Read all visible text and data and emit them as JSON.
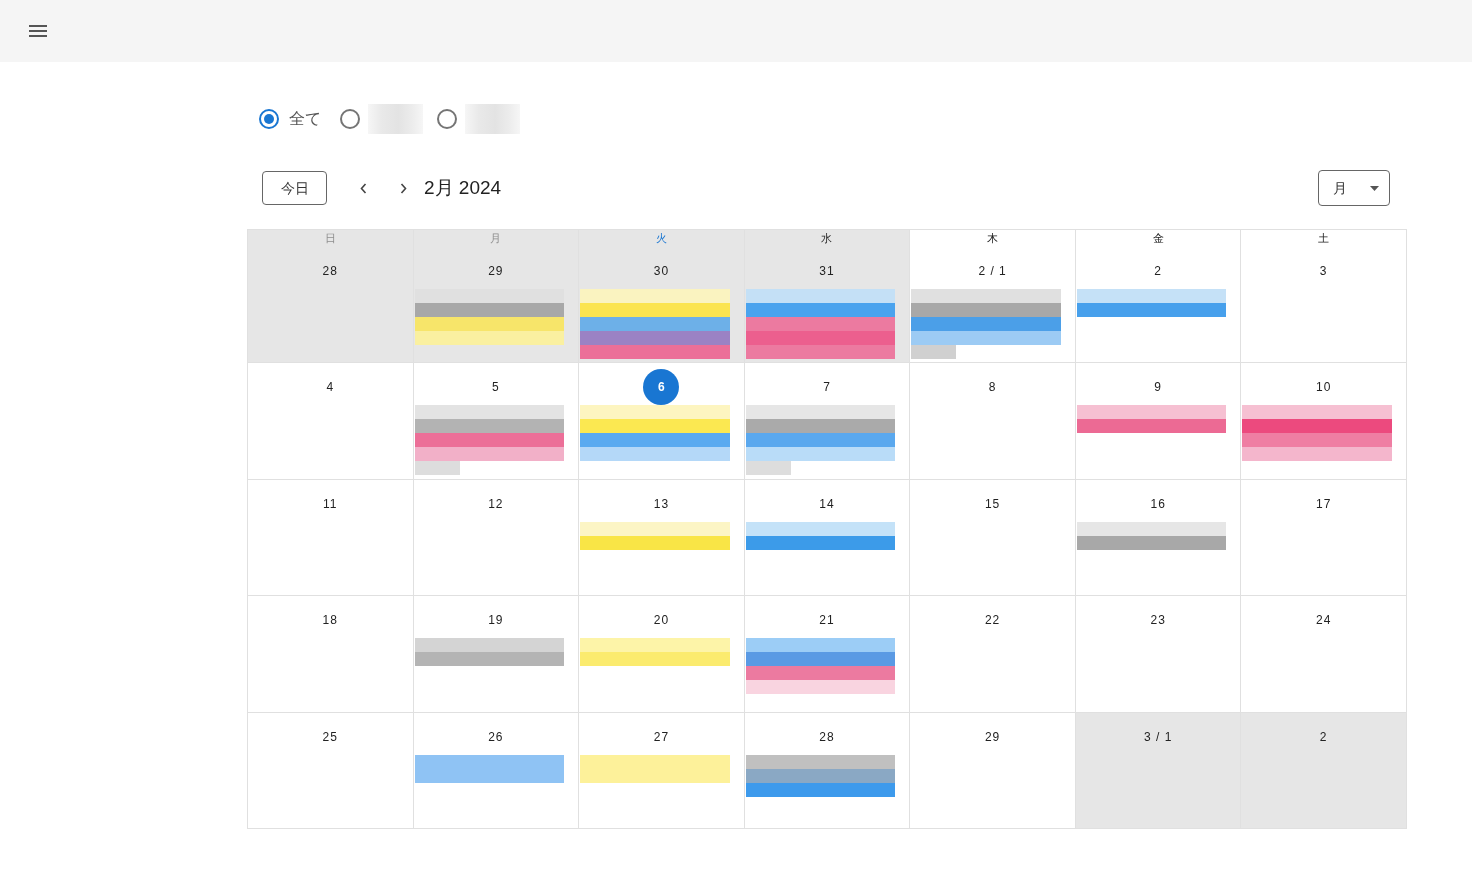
{
  "filters": [
    {
      "label": "全て",
      "selected": true
    },
    {
      "selected": false
    },
    {
      "selected": false
    }
  ],
  "toolbar": {
    "today_button": "今日",
    "title": "2月 2024",
    "view_button": "月"
  },
  "calendar": {
    "weekdays": [
      {
        "label": "日",
        "kind": "past"
      },
      {
        "label": "月",
        "kind": "past"
      },
      {
        "label": "火",
        "kind": "today"
      },
      {
        "label": "水",
        "kind": "future"
      },
      {
        "label": "木",
        "kind": "future"
      },
      {
        "label": "金",
        "kind": "future"
      },
      {
        "label": "土",
        "kind": "future"
      }
    ],
    "weeks": [
      {
        "days": [
          {
            "label": "28",
            "outside": true,
            "today": false
          },
          {
            "label": "29",
            "outside": true,
            "today": false,
            "events": [
              {
                "kind": "bar",
                "color": "#e0e0e0"
              },
              {
                "kind": "bar",
                "color": "#a8a8a8"
              },
              {
                "kind": "bar",
                "color": "#f7e56a"
              },
              {
                "kind": "bar",
                "color": "#faf0a0"
              }
            ]
          },
          {
            "label": "30",
            "outside": true,
            "today": false,
            "events": [
              {
                "kind": "bar",
                "color": "#faf3c0"
              },
              {
                "kind": "bar",
                "color": "#fbe44f"
              },
              {
                "kind": "bar",
                "color": "#6db0e8"
              },
              {
                "kind": "bar",
                "color": "#9b82c4"
              },
              {
                "kind": "bar",
                "color": "#ec6f98"
              }
            ]
          },
          {
            "label": "31",
            "outside": true,
            "today": false,
            "events": [
              {
                "kind": "bar",
                "color": "#c4e0f6"
              },
              {
                "kind": "bar",
                "color": "#4aa3ee"
              },
              {
                "kind": "bar",
                "color": "#ec7aa0"
              },
              {
                "kind": "bar",
                "color": "#ec5f8e"
              },
              {
                "kind": "bar",
                "color": "#ec7aa0"
              }
            ]
          },
          {
            "label": "2 / 1",
            "outside": false,
            "today": false,
            "events": [
              {
                "kind": "bar",
                "color": "#e0e0e0"
              },
              {
                "kind": "bar",
                "color": "#a8a8a8"
              },
              {
                "kind": "bar",
                "color": "#4b9fe8"
              },
              {
                "kind": "bar",
                "color": "#9ccbf4"
              },
              {
                "kind": "stub",
                "color": "#d0d0d0"
              }
            ]
          },
          {
            "label": "2",
            "outside": false,
            "today": false,
            "events": [
              {
                "kind": "bar",
                "color": "#c5e1f7"
              },
              {
                "kind": "bar",
                "color": "#47a0ec"
              }
            ]
          },
          {
            "label": "3",
            "outside": false,
            "today": false
          }
        ]
      },
      {
        "days": [
          {
            "label": "4",
            "outside": false,
            "today": false
          },
          {
            "label": "5",
            "outside": false,
            "today": false,
            "events": [
              {
                "kind": "bar",
                "color": "#e3e3e3"
              },
              {
                "kind": "bar",
                "color": "#b3b3b3"
              },
              {
                "kind": "bar",
                "color": "#ec6f98"
              },
              {
                "kind": "bar",
                "color": "#f2b0c8"
              },
              {
                "kind": "stub",
                "color": "#dddddd"
              }
            ]
          },
          {
            "label": "6",
            "outside": false,
            "today": true,
            "events": [
              {
                "kind": "bar",
                "color": "#fdf5c0"
              },
              {
                "kind": "bar",
                "color": "#fbe851"
              },
              {
                "kind": "bar",
                "color": "#5aaaf0"
              },
              {
                "kind": "bar",
                "color": "#b4d8f8"
              }
            ]
          },
          {
            "label": "7",
            "outside": false,
            "today": false,
            "events": [
              {
                "kind": "bar",
                "color": "#e6e6e6"
              },
              {
                "kind": "bar",
                "color": "#aaaaaa"
              },
              {
                "kind": "bar",
                "color": "#5aa8ee"
              },
              {
                "kind": "bar",
                "color": "#b9dcf8"
              },
              {
                "kind": "stub",
                "color": "#dddddd"
              }
            ]
          },
          {
            "label": "8",
            "outside": false,
            "today": false
          },
          {
            "label": "9",
            "outside": false,
            "today": false,
            "events": [
              {
                "kind": "bar",
                "color": "#f6c0d2"
              },
              {
                "kind": "bar",
                "color": "#ec6a94"
              }
            ]
          },
          {
            "label": "10",
            "outside": false,
            "today": false,
            "events": [
              {
                "kind": "bar",
                "color": "#f6c0d2"
              },
              {
                "kind": "bar",
                "color": "#ec4a7e"
              },
              {
                "kind": "bar",
                "color": "#ef7ea3"
              },
              {
                "kind": "bar",
                "color": "#f4b6cc"
              }
            ]
          }
        ]
      },
      {
        "days": [
          {
            "label": "11",
            "outside": false,
            "today": false
          },
          {
            "label": "12",
            "outside": false,
            "today": false
          },
          {
            "label": "13",
            "outside": false,
            "today": false,
            "events": [
              {
                "kind": "bar",
                "color": "#fcf5c5"
              },
              {
                "kind": "bar",
                "color": "#f9e546"
              }
            ]
          },
          {
            "label": "14",
            "outside": false,
            "today": false,
            "events": [
              {
                "kind": "bar",
                "color": "#c4e2f8"
              },
              {
                "kind": "bar",
                "color": "#3c9be9"
              }
            ]
          },
          {
            "label": "15",
            "outside": false,
            "today": false
          },
          {
            "label": "16",
            "outside": false,
            "today": false,
            "events": [
              {
                "kind": "bar",
                "color": "#e6e6e6"
              },
              {
                "kind": "bar",
                "color": "#a8a8a8"
              }
            ]
          },
          {
            "label": "17",
            "outside": false,
            "today": false
          }
        ]
      },
      {
        "days": [
          {
            "label": "18",
            "outside": false,
            "today": false
          },
          {
            "label": "19",
            "outside": false,
            "today": false,
            "events": [
              {
                "kind": "bar",
                "color": "#d4d4d4"
              },
              {
                "kind": "bar",
                "color": "#b4b4b4"
              }
            ]
          },
          {
            "label": "20",
            "outside": false,
            "today": false,
            "events": [
              {
                "kind": "bar",
                "color": "#fdf4a8"
              },
              {
                "kind": "bar",
                "color": "#fbeb6e"
              }
            ]
          },
          {
            "label": "21",
            "outside": false,
            "today": false,
            "events": [
              {
                "kind": "bar",
                "color": "#9ccdf6"
              },
              {
                "kind": "bar",
                "color": "#5a9ae4"
              },
              {
                "kind": "bar",
                "color": "#ec7aa0"
              },
              {
                "kind": "bar",
                "color": "#f9d4e0"
              }
            ]
          },
          {
            "label": "22",
            "outside": false,
            "today": false
          },
          {
            "label": "23",
            "outside": false,
            "today": false
          },
          {
            "label": "24",
            "outside": false,
            "today": false
          }
        ]
      },
      {
        "days": [
          {
            "label": "25",
            "outside": false,
            "today": false
          },
          {
            "label": "26",
            "outside": false,
            "today": false,
            "events": [
              {
                "kind": "bar",
                "color": "#8fc3f4"
              },
              {
                "kind": "bar",
                "color": "#8fc3f4"
              }
            ]
          },
          {
            "label": "27",
            "outside": false,
            "today": false,
            "events": [
              {
                "kind": "bar",
                "color": "#fdf19a"
              },
              {
                "kind": "bar",
                "color": "#fdf19a"
              }
            ]
          },
          {
            "label": "28",
            "outside": false,
            "today": false,
            "events": [
              {
                "kind": "bar",
                "color": "#c0c0c0"
              },
              {
                "kind": "bar",
                "color": "#8aa8c4"
              },
              {
                "kind": "bar",
                "color": "#3d9aec"
              }
            ]
          },
          {
            "label": "29",
            "outside": false,
            "today": false
          },
          {
            "label": "3 / 1",
            "outside": true,
            "today": false
          },
          {
            "label": "2",
            "outside": true,
            "today": false
          }
        ]
      }
    ]
  }
}
